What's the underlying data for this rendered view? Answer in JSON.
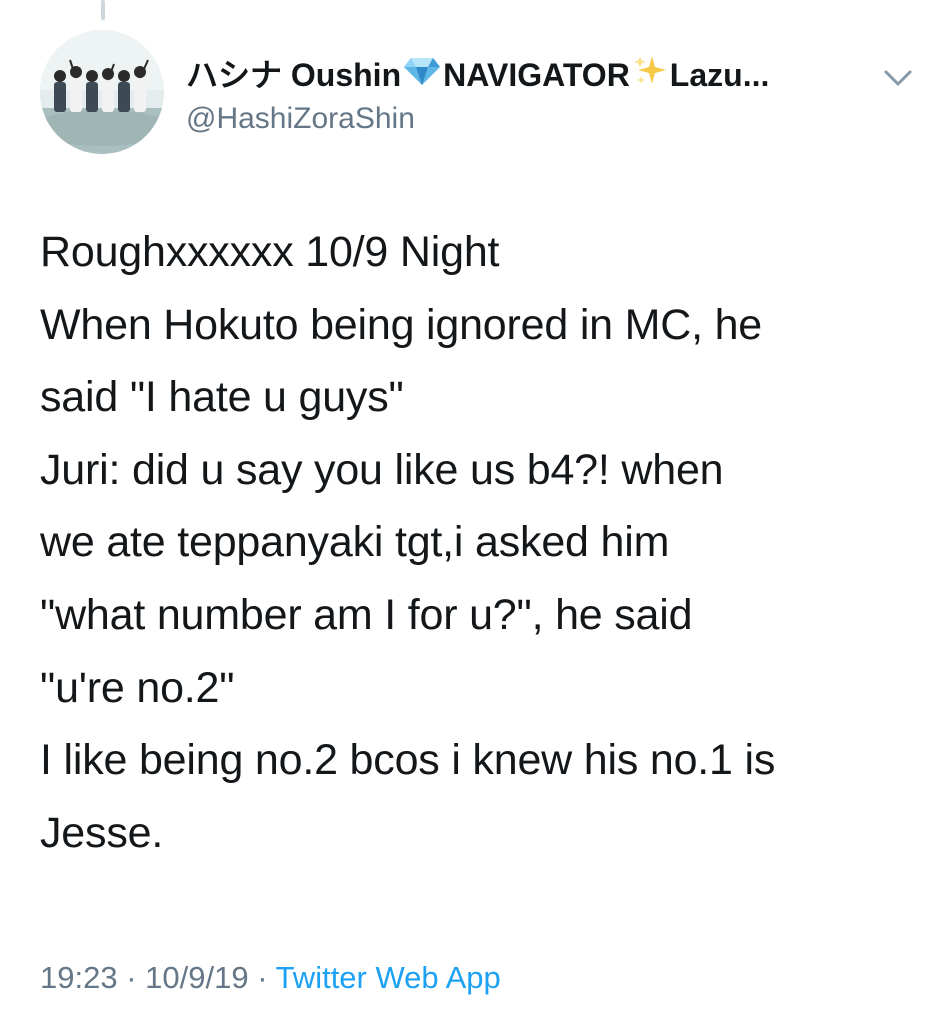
{
  "author": {
    "display_name_part1": "ハシナ Oushin",
    "display_name_emoji1": "gem-icon",
    "display_name_part2": "NAVIGATOR",
    "display_name_emoji2": "sparkles-icon",
    "display_name_part3": "Lazu...",
    "handle": "@HashiZoraShin",
    "avatar_icon": "group-photo-avatar"
  },
  "tweet": {
    "lines": [
      "Roughxxxxxx 10/9 Night",
      "When Hokuto being ignored in MC, he",
      "said \"I hate u guys\"",
      "Juri: did u say you like us b4?! when",
      "we ate teppanyaki tgt,i asked him",
      "\"what number am I for u?\", he said",
      "\"u're no.2\"",
      "I like being no.2 bcos i knew his no.1 is",
      "Jesse."
    ]
  },
  "meta": {
    "time": "19:23",
    "separator1": " · ",
    "date": "10/9/19",
    "separator2": " · ",
    "source": "Twitter Web App"
  },
  "colors": {
    "text": "#14171a",
    "secondary": "#657786",
    "link": "#1da1f2",
    "divider": "#ccd6dd"
  },
  "icons": {
    "menu": "chevron-down-icon"
  }
}
